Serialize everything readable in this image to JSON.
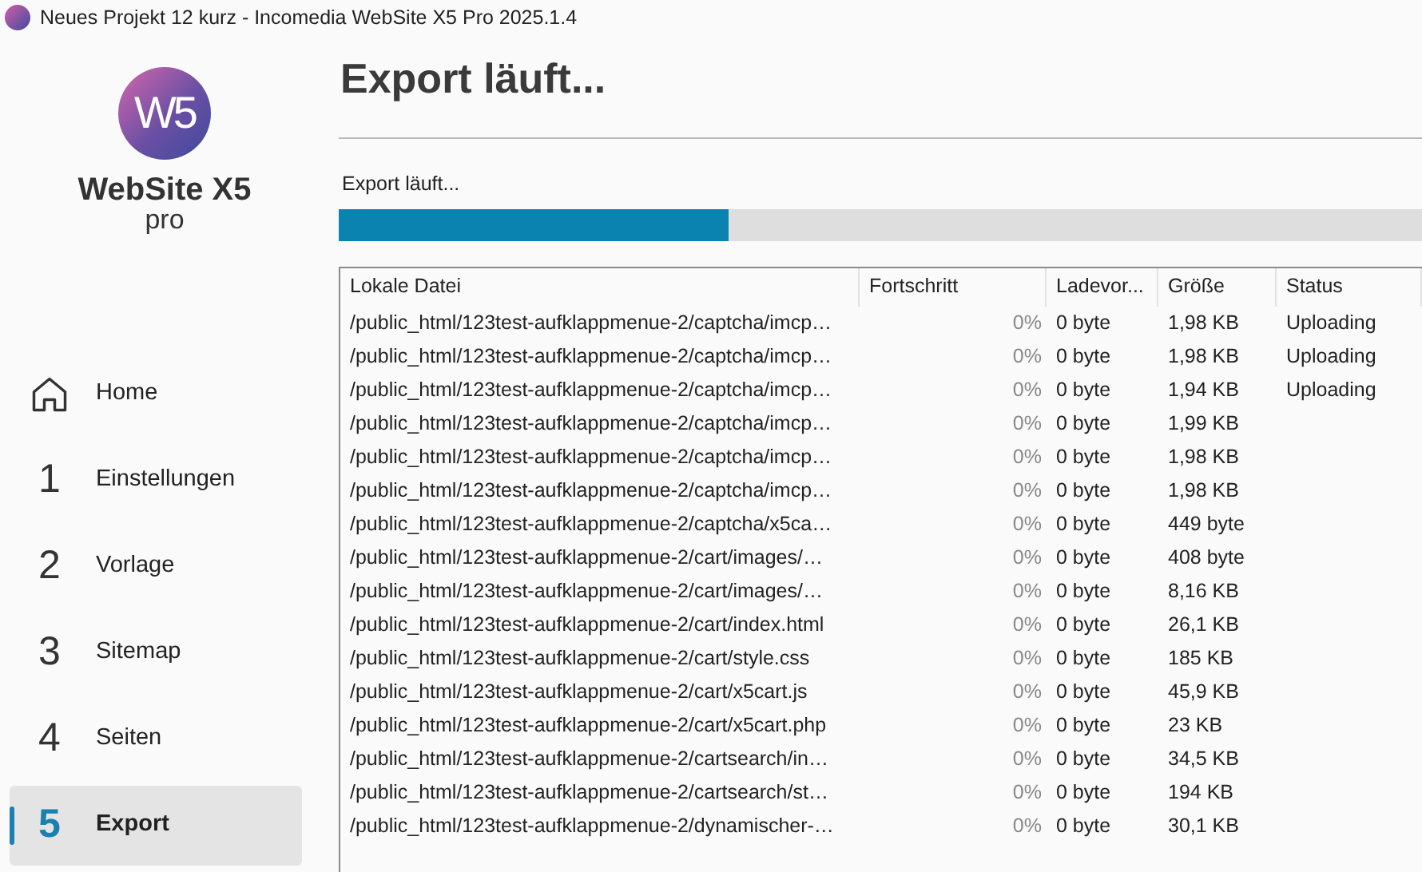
{
  "window": {
    "title": "Neues Projekt 12 kurz - Incomedia WebSite X5 Pro 2025.1.4"
  },
  "logo": {
    "mark": "W5",
    "name": "WebSite X5",
    "edition": "pro"
  },
  "sidebar": {
    "items": [
      {
        "kind": "home",
        "label": "Home",
        "selected": false
      },
      {
        "kind": "step",
        "number": "1",
        "label": "Einstellungen",
        "selected": false
      },
      {
        "kind": "step",
        "number": "2",
        "label": "Vorlage",
        "selected": false
      },
      {
        "kind": "step",
        "number": "3",
        "label": "Sitemap",
        "selected": false
      },
      {
        "kind": "step",
        "number": "4",
        "label": "Seiten",
        "selected": false
      },
      {
        "kind": "step",
        "number": "5",
        "label": "Export",
        "selected": true
      }
    ]
  },
  "heading": "Export läuft...",
  "progress": {
    "label": "Export läuft...",
    "level": 0.36
  },
  "table": {
    "columns": [
      "Lokale Datei",
      "Fortschritt",
      "Ladevor...",
      "Größe",
      "Status"
    ],
    "rows": [
      [
        "/public_html/123test-aufklappmenue-2/captcha/imcp…",
        "0%",
        "0 byte",
        "1,98 KB",
        "Uploading"
      ],
      [
        "/public_html/123test-aufklappmenue-2/captcha/imcp…",
        "0%",
        "0 byte",
        "1,98 KB",
        "Uploading"
      ],
      [
        "/public_html/123test-aufklappmenue-2/captcha/imcp…",
        "0%",
        "0 byte",
        "1,94 KB",
        "Uploading"
      ],
      [
        "/public_html/123test-aufklappmenue-2/captcha/imcp…",
        "0%",
        "0 byte",
        "1,99 KB"
      ],
      [
        "/public_html/123test-aufklappmenue-2/captcha/imcp…",
        "0%",
        "0 byte",
        "1,98 KB"
      ],
      [
        "/public_html/123test-aufklappmenue-2/captcha/imcp…",
        "0%",
        "0 byte",
        "1,98 KB"
      ],
      [
        "/public_html/123test-aufklappmenue-2/captcha/x5ca…",
        "0%",
        "0 byte",
        "449 byte"
      ],
      [
        "/public_html/123test-aufklappmenue-2/cart/images/…",
        "0%",
        "0 byte",
        "408 byte"
      ],
      [
        "/public_html/123test-aufklappmenue-2/cart/images/…",
        "0%",
        "0 byte",
        "8,16 KB"
      ],
      [
        "/public_html/123test-aufklappmenue-2/cart/index.html",
        "0%",
        "0 byte",
        "26,1 KB"
      ],
      [
        "/public_html/123test-aufklappmenue-2/cart/style.css",
        "0%",
        "0 byte",
        "185 KB"
      ],
      [
        "/public_html/123test-aufklappmenue-2/cart/x5cart.js",
        "0%",
        "0 byte",
        "45,9 KB"
      ],
      [
        "/public_html/123test-aufklappmenue-2/cart/x5cart.php",
        "0%",
        "0 byte",
        "23 KB"
      ],
      [
        "/public_html/123test-aufklappmenue-2/cartsearch/in…",
        "0%",
        "0 byte",
        "34,5 KB"
      ],
      [
        "/public_html/123test-aufklappmenue-2/cartsearch/st…",
        "0%",
        "0 byte",
        "194 KB"
      ],
      [
        "/public_html/123test-aufklappmenue-2/dynamischer-…",
        "0%",
        "0 byte",
        "30,1 KB"
      ]
    ]
  }
}
